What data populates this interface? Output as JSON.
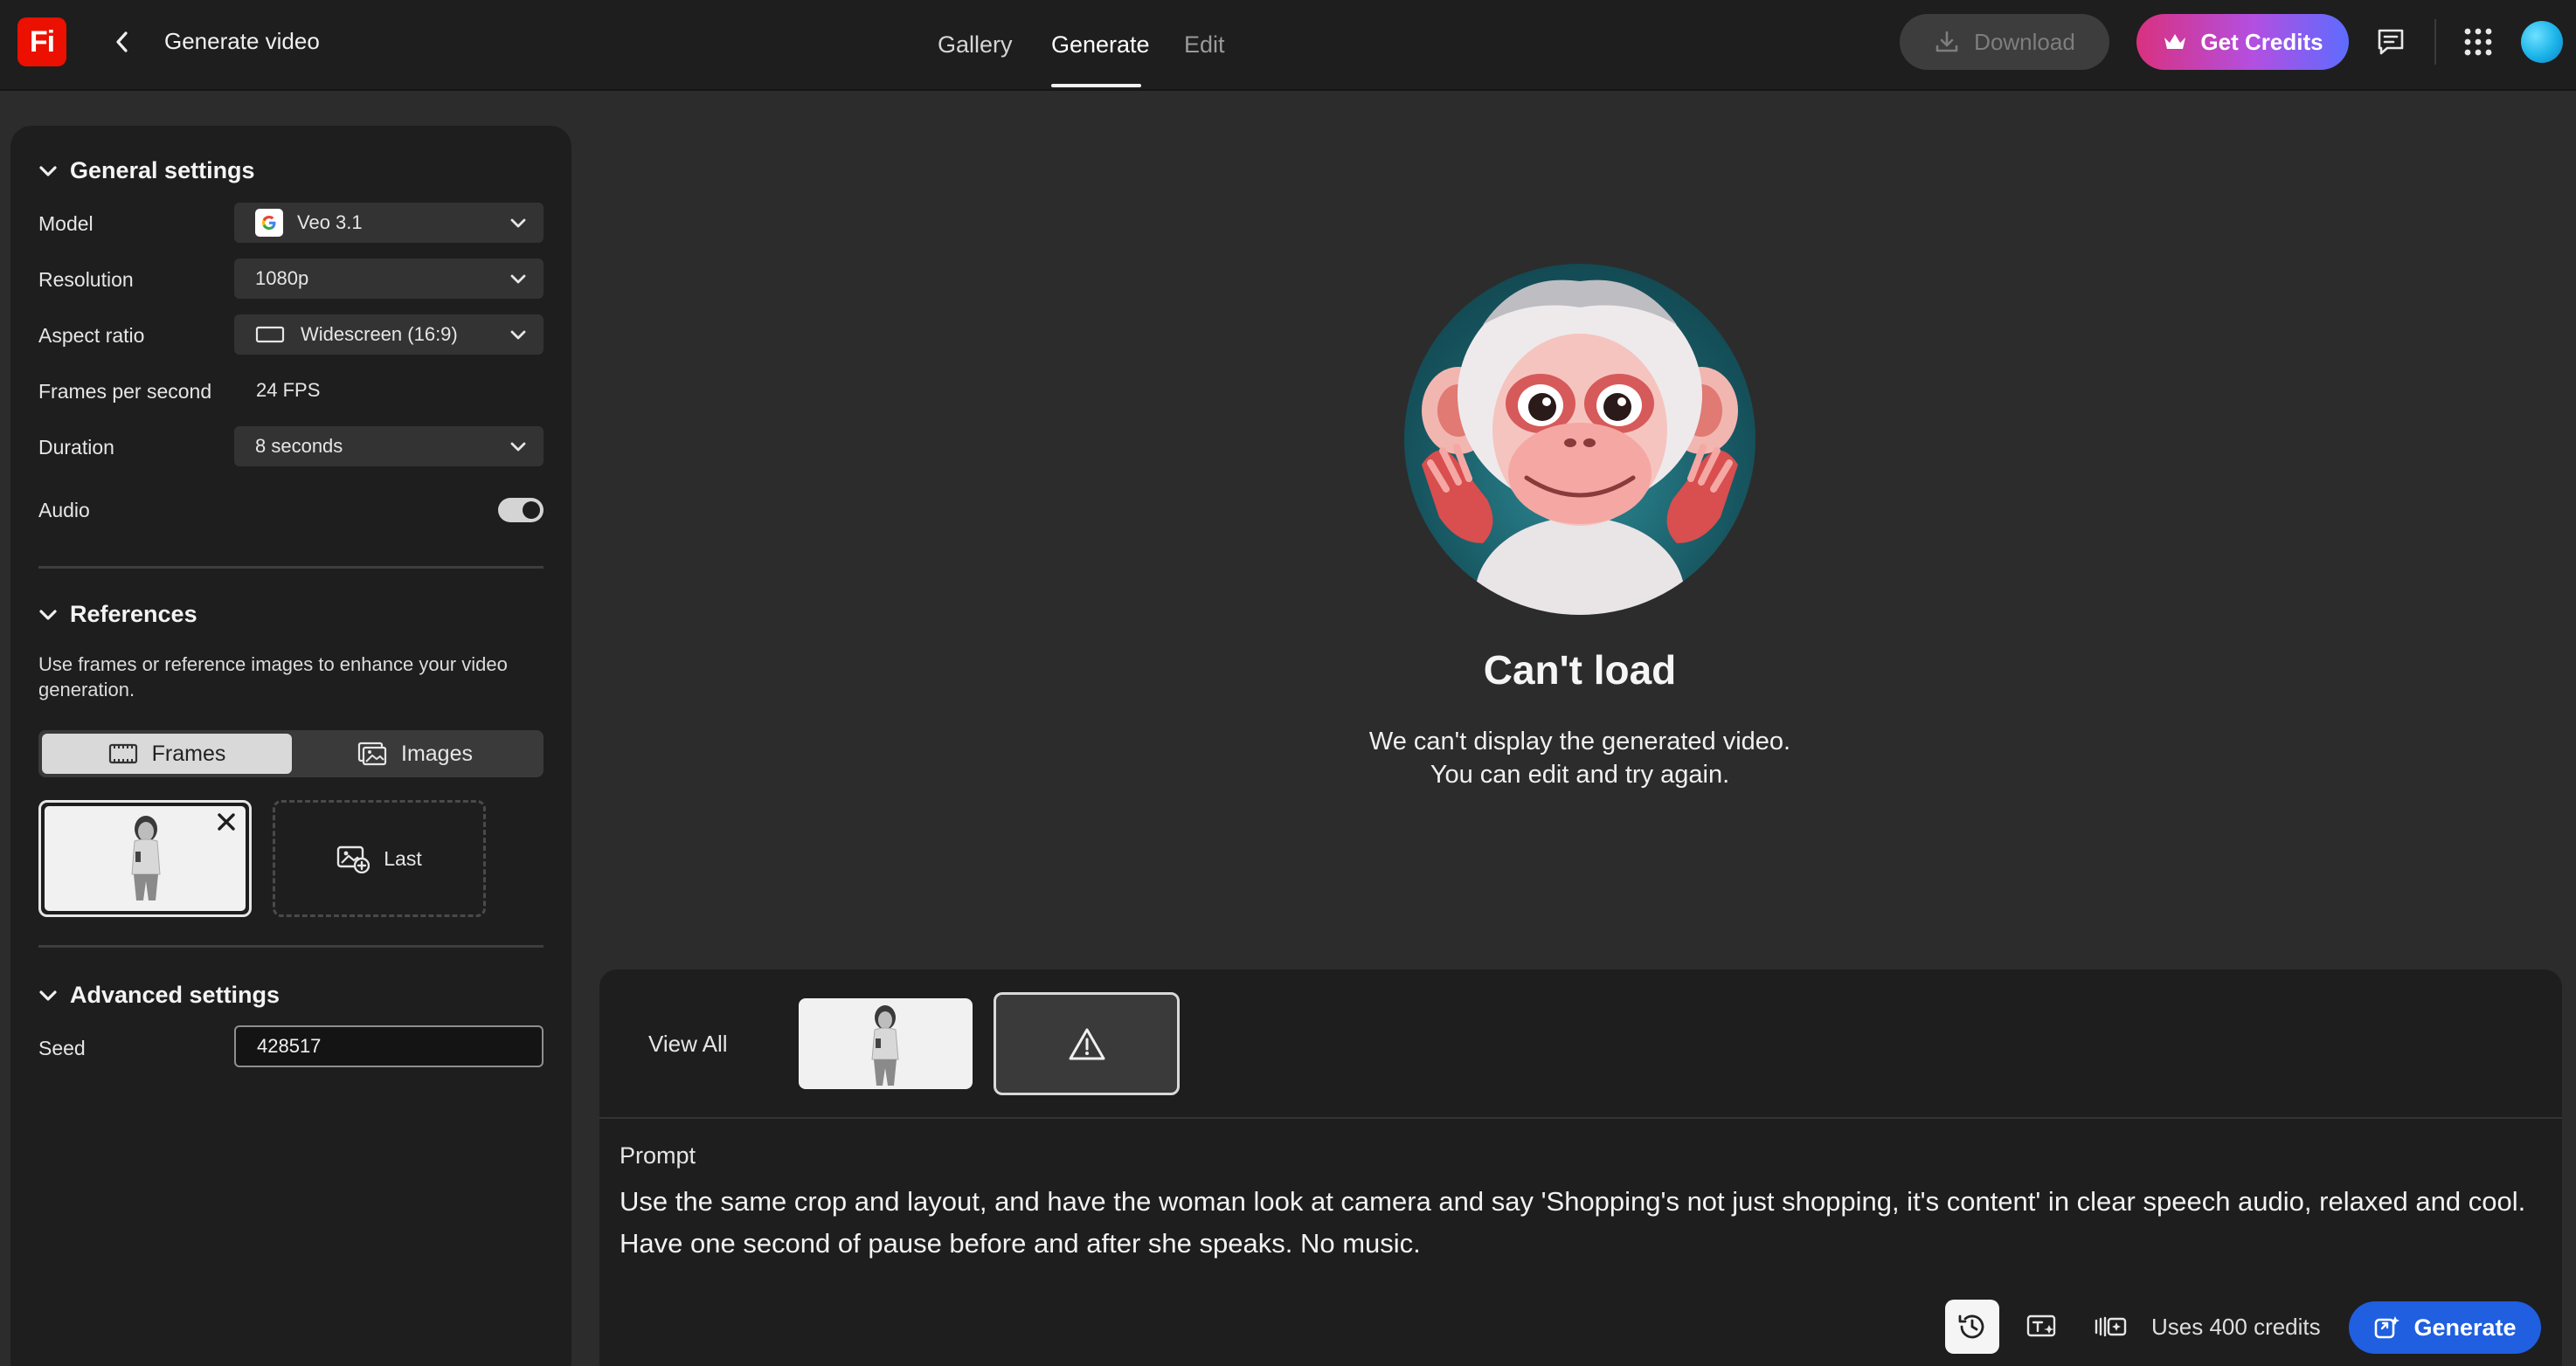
{
  "header": {
    "logo_text": "Fi",
    "title": "Generate video",
    "tabs": [
      {
        "label": "Gallery"
      },
      {
        "label": "Generate"
      },
      {
        "label": "Edit"
      }
    ],
    "download_label": "Download",
    "get_credits_label": "Get Credits"
  },
  "general": {
    "title": "General settings",
    "model_label": "Model",
    "model_value": "Veo 3.1",
    "resolution_label": "Resolution",
    "resolution_value": "1080p",
    "aspect_label": "Aspect ratio",
    "aspect_value": "Widescreen (16:9)",
    "fps_label": "Frames per second",
    "fps_value": "24 FPS",
    "duration_label": "Duration",
    "duration_value": "8 seconds",
    "audio_label": "Audio",
    "audio_on": true
  },
  "references": {
    "title": "References",
    "description": "Use frames or reference images to enhance your video generation.",
    "frames_label": "Frames",
    "images_label": "Images",
    "last_label": "Last"
  },
  "advanced": {
    "title": "Advanced settings",
    "seed_label": "Seed",
    "seed_value": "428517"
  },
  "error": {
    "title": "Can't load",
    "line1": "We can't display the generated video.",
    "line2": "You can edit and try again."
  },
  "history": {
    "view_all_label": "View All"
  },
  "prompt": {
    "label": "Prompt",
    "text": "Use the same crop and layout, and have the woman look at camera and say 'Shopping's not just shopping, it's content' in clear speech audio, relaxed and cool. Have one second of pause before and after she speaks. No music."
  },
  "footer": {
    "uses_credits": "Uses 400 credits",
    "generate_label": "Generate"
  },
  "colors": {
    "accent_blue": "#1f5fe0",
    "brand_red": "#eb1000",
    "credits_gradient_start": "#d9317f",
    "credits_gradient_end": "#5d6cff"
  }
}
